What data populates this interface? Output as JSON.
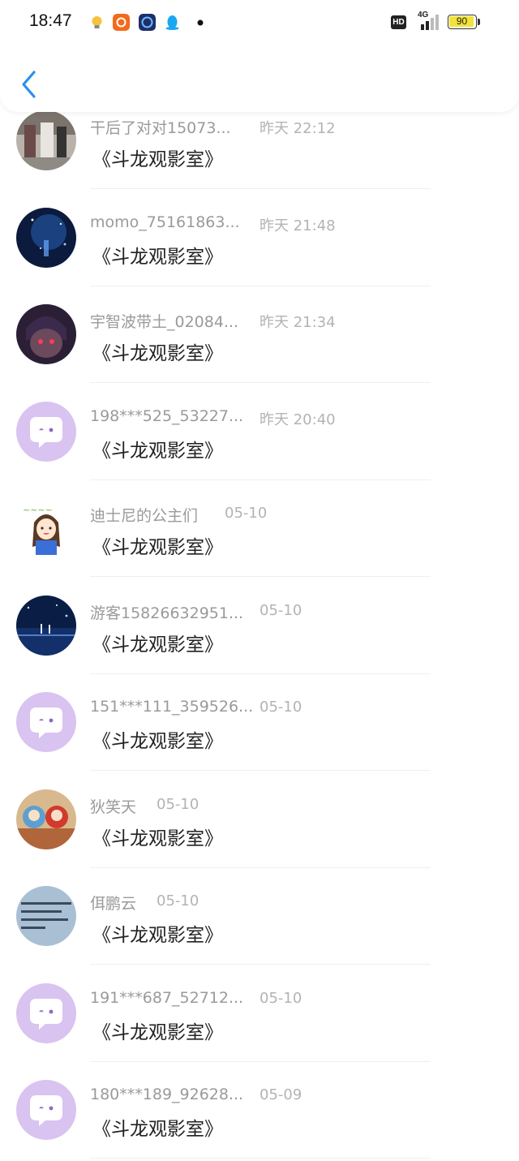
{
  "status_bar": {
    "time": "18:47",
    "hd": "HD",
    "network": "4G",
    "battery": "90"
  },
  "header": {
    "back_icon": "chevron-left-icon",
    "accent": "#2b8ff0"
  },
  "contacts": [
    {
      "name": "干后了对对15073...",
      "time": "昨天 22:12",
      "message": "《斗龙观影室》",
      "avatar": "photo-street"
    },
    {
      "name": "momo_75161863...",
      "time": "昨天 21:48",
      "message": "《斗龙观影室》",
      "avatar": "photo-night-sky"
    },
    {
      "name": "宇智波带土_02084...",
      "time": "昨天 21:34",
      "message": "《斗龙观影室》",
      "avatar": "photo-anime-dark"
    },
    {
      "name": "198***525_53227...",
      "time": "昨天 20:40",
      "message": "《斗龙观影室》",
      "avatar": "default-chat-bubble"
    },
    {
      "name": "迪士尼的公主们",
      "time": "05-10",
      "message": "《斗龙观影室》",
      "avatar": "photo-cartoon-girl"
    },
    {
      "name": "游客15826632951...",
      "time": "05-10",
      "message": "《斗龙观影室》",
      "avatar": "photo-blue-night"
    },
    {
      "name": "151***111_359526...",
      "time": "05-10",
      "message": "《斗龙观影室》",
      "avatar": "default-chat-bubble"
    },
    {
      "name": "狄笑天",
      "time": "05-10",
      "message": "《斗龙观影室》",
      "avatar": "photo-dolls"
    },
    {
      "name": "佴鹏云",
      "time": "05-10",
      "message": "《斗龙观影室》",
      "avatar": "photo-handwriting"
    },
    {
      "name": "191***687_52712...",
      "time": "05-10",
      "message": "《斗龙观影室》",
      "avatar": "default-chat-bubble"
    },
    {
      "name": "180***189_92628...",
      "time": "05-09",
      "message": "《斗龙观影室》",
      "avatar": "default-chat-bubble"
    }
  ]
}
